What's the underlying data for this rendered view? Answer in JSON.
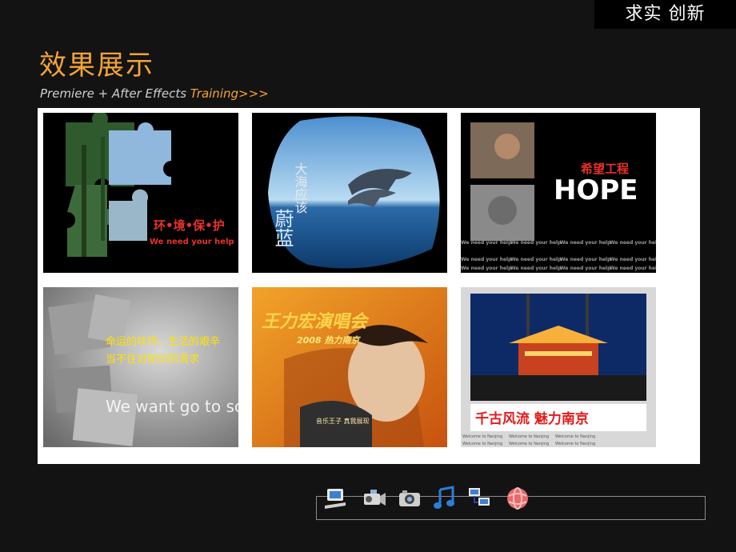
{
  "badge": {
    "text": "求实 创新"
  },
  "page": {
    "title": "效果展示",
    "subtitle_prefix": "Premiere + After Effects ",
    "subtitle_highlight": "Training>>>"
  },
  "thumbnails": [
    {
      "id": "puzzle",
      "cn": "环•境•保•护",
      "en": "We need your help"
    },
    {
      "id": "dolphin",
      "vertical_a": "大海应该",
      "vertical_b": "蔚蓝"
    },
    {
      "id": "hope",
      "cn": "希望工程",
      "en": "HOPE",
      "repeat": "We need your help"
    },
    {
      "id": "school",
      "cn_line1": "命运的坎坷，生活的艰辛",
      "cn_line2": "当不住对知识的渴求",
      "en": "We want go to schoo"
    },
    {
      "id": "concert",
      "cn": "王力宏演唱会",
      "year": "2008 热力南京",
      "tag": "音乐王子 真我展现"
    },
    {
      "id": "nanjing",
      "cn": "千古风流 魅力南京",
      "repeat": "Welcome to Nanjing"
    }
  ],
  "dock_icons": [
    "computer-icon",
    "camcorder-icon",
    "camera-icon",
    "music-note-icon",
    "network-icon",
    "globe-icon"
  ],
  "colors": {
    "accent": "#f4a436",
    "background": "#131313",
    "panel": "#ffffff"
  }
}
